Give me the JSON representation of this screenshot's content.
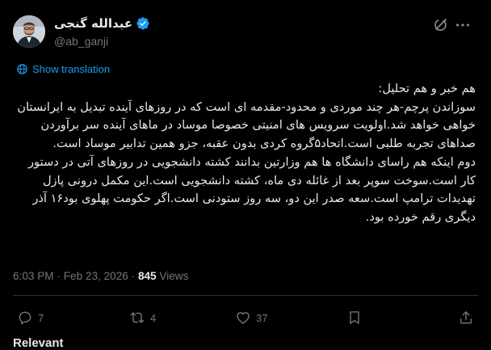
{
  "author": {
    "display_name": "عبدالله گنجی",
    "handle": "@ab_ganji",
    "verified_icon": "verified-badge-icon",
    "avatar_icon": "profile-photo"
  },
  "header_actions": {
    "grok_icon": "grok-icon",
    "more_label": "···"
  },
  "translation": {
    "label": "Show translation",
    "icon": "globe-icon"
  },
  "tweet": {
    "paragraphs": [
      "هم خبر و هم تحلیل:",
      "سوزاندن پرچم-هر چند موردی و محدود-مقدمه ای است که در روزهای آینده تبدیل به ایرانستان خواهی خواهد شد.اولویت سرویس های امنیتی خصوصا موساد در ماهای آینده سر برآوردن صداهای تجربه طلبی است.اتحاد۵گروه کردی بدون عقبه، جزو همین تدابیر موساد است.",
      "دوم اینکه هم راسای دانشگاه ها هم وزارتین بدانند کشته دانشجویی در روزهای آتی در دستور کار است.سوخت سوپر بعد از غائله دی ماه، کشته دانشجویی است.این مکمل درونی پازل تهدیدات ترامپ است.سعه صدر این دو، سه روز ستودنی است.اگر حکومت پهلوی بود۱۶ آذر دیگری رقم خورده بود."
    ]
  },
  "meta": {
    "time": "6:03 PM",
    "separator": "·",
    "date": "Feb 23, 2026",
    "views_count": "845",
    "views_label": "Views"
  },
  "actions": {
    "reply_count": "7",
    "repost_count": "4",
    "like_count": "37"
  },
  "footer": {
    "relevant_label": "Relevant"
  },
  "colors": {
    "background": "#000000",
    "text_primary": "#e7e9ea",
    "text_secondary": "#71767b",
    "accent": "#1d9bf0",
    "divider": "#2f3336"
  }
}
